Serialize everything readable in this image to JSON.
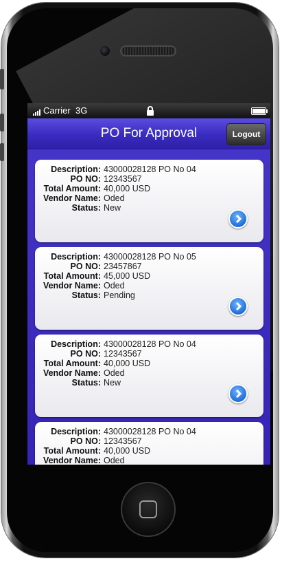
{
  "status_bar": {
    "carrier": "Carrier",
    "network": "3G"
  },
  "nav": {
    "title": "PO For Approval",
    "logout_label": "Logout"
  },
  "labels": {
    "description": "Description:",
    "po_no": "PO NO:",
    "total_amount": "Total Amount:",
    "vendor_name": "Vendor Name:",
    "status": "Status:"
  },
  "orders": [
    {
      "description": "43000028128 PO No 04",
      "po_no": "12343567",
      "total_amount": "40,000 USD",
      "vendor_name": "Oded",
      "status": "New"
    },
    {
      "description": "43000028128 PO No 05",
      "po_no": "23457867",
      "total_amount": "45,000 USD",
      "vendor_name": "Oded",
      "status": "Pending"
    },
    {
      "description": "43000028128 PO No 04",
      "po_no": "12343567",
      "total_amount": "40,000 USD",
      "vendor_name": "Oded",
      "status": "New"
    },
    {
      "description": "43000028128 PO No 04",
      "po_no": "12343567",
      "total_amount": "40,000 USD",
      "vendor_name": "Oded",
      "status": ""
    }
  ],
  "colors": {
    "nav_bar": "#3a2bc0",
    "list_background": "#3a2bb0",
    "disclosure_button": "#1f6ed8"
  }
}
